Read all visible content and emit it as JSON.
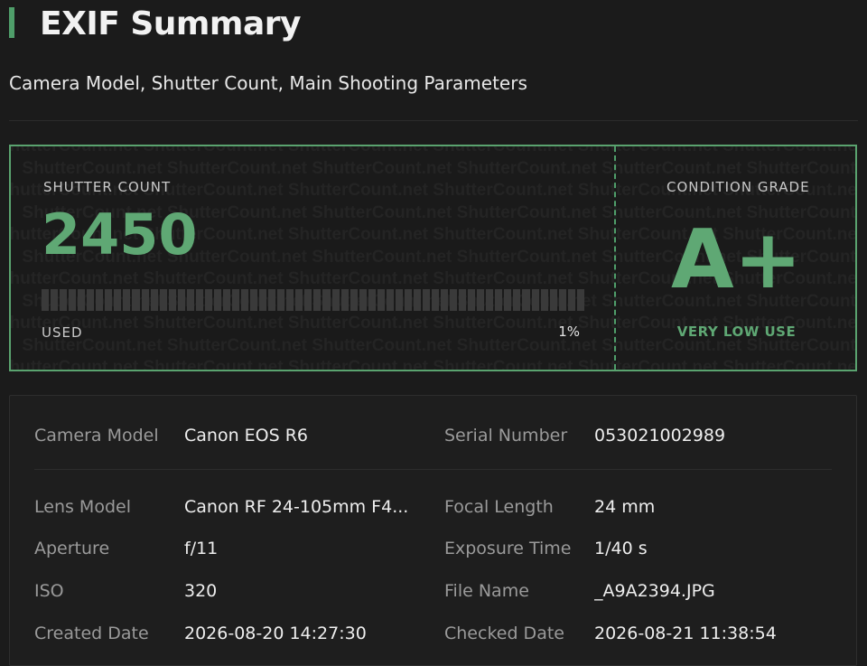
{
  "header": {
    "title": "EXIF Summary",
    "subtitle": "Camera Model, Shutter Count, Main Shooting Parameters"
  },
  "summary": {
    "watermark_text": "ShutterCount.net",
    "shutter_count_label": "SHUTTER COUNT",
    "shutter_count": "2450",
    "usage_label": "USED",
    "usage_percent": "1%",
    "usage_fraction": 0.01,
    "condition_label": "CONDITION GRADE",
    "condition_grade": "A+",
    "condition_text": "VERY LOW USE",
    "accent_color": "#5fa874"
  },
  "details": {
    "rows": [
      [
        {
          "key": "Camera Model",
          "value": "Canon EOS R6"
        },
        {
          "key": "Serial Number",
          "value": "053021002989"
        }
      ],
      [
        {
          "key": "Lens Model",
          "value": "Canon RF 24-105mm F4..."
        },
        {
          "key": "Focal Length",
          "value": "24 mm"
        }
      ],
      [
        {
          "key": "Aperture",
          "value": "f/11"
        },
        {
          "key": "Exposure Time",
          "value": "1/40 s"
        }
      ],
      [
        {
          "key": "ISO",
          "value": "320"
        },
        {
          "key": "File Name",
          "value": "_A9A2394.JPG"
        }
      ],
      [
        {
          "key": "Created Date",
          "value": "2026-08-20 14:27:30"
        },
        {
          "key": "Checked Date",
          "value": "2026-08-21 11:38:54"
        }
      ]
    ]
  }
}
